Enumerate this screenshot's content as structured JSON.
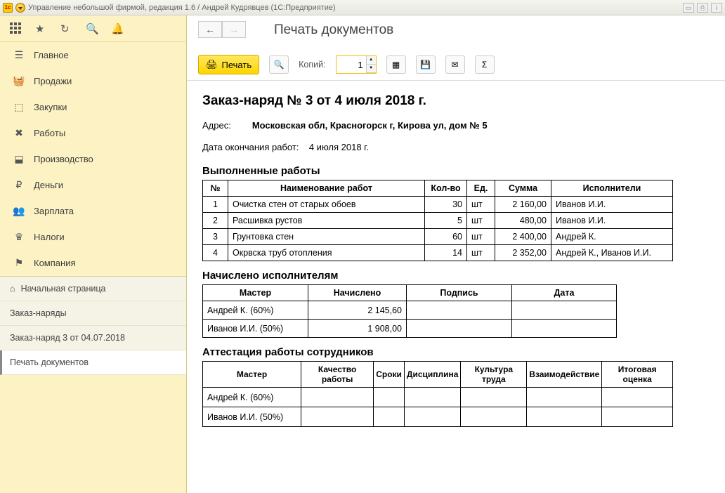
{
  "app": {
    "title": "Управление небольшой фирмой, редакция 1.6 / Андрей Кудрявцев  (1С:Предприятие)"
  },
  "sidebar": {
    "items": [
      {
        "icon": "☰",
        "label": "Главное"
      },
      {
        "icon": "🧺",
        "label": "Продажи"
      },
      {
        "icon": "⬚",
        "label": "Закупки"
      },
      {
        "icon": "✖",
        "label": "Работы"
      },
      {
        "icon": "⬓",
        "label": "Производство"
      },
      {
        "icon": "₽",
        "label": "Деньги"
      },
      {
        "icon": "👥",
        "label": "Зарплата"
      },
      {
        "icon": "♛",
        "label": "Налоги"
      },
      {
        "icon": "⚑",
        "label": "Компания"
      }
    ],
    "sub": [
      {
        "icon": "⌂",
        "label": "Начальная страница"
      },
      {
        "icon": "",
        "label": "Заказ-наряды"
      },
      {
        "icon": "",
        "label": "Заказ-наряд 3 от 04.07.2018"
      },
      {
        "icon": "",
        "label": "Печать документов"
      }
    ]
  },
  "page": {
    "title": "Печать документов",
    "print_label": "Печать",
    "copies_label": "Копий:",
    "copies_value": "1"
  },
  "document": {
    "title": "Заказ-наряд № 3 от 4 июля 2018 г.",
    "address_label": "Адрес:",
    "address_value": "Московская обл, Красногорск г, Кирова ул, дом № 5",
    "enddate_label": "Дата окончания работ:",
    "enddate_value": "4 июля 2018 г.",
    "works": {
      "heading": "Выполненные работы",
      "headers": [
        "№",
        "Наименование работ",
        "Кол-во",
        "Ед.",
        "Сумма",
        "Исполнители"
      ],
      "rows": [
        {
          "n": "1",
          "name": "Очистка стен от старых обоев",
          "qty": "30",
          "unit": "шт",
          "sum": "2 160,00",
          "exec": "Иванов И.И."
        },
        {
          "n": "2",
          "name": "Расшивка рустов",
          "qty": "5",
          "unit": "шт",
          "sum": "480,00",
          "exec": "Иванов И.И."
        },
        {
          "n": "3",
          "name": "Грунтовка стен",
          "qty": "60",
          "unit": "шт",
          "sum": "2 400,00",
          "exec": "Андрей К."
        },
        {
          "n": "4",
          "name": "Окрвска труб отопления",
          "qty": "14",
          "unit": "шт",
          "sum": "2 352,00",
          "exec": "Андрей К., Иванов И.И."
        }
      ]
    },
    "accrued": {
      "heading": "Начислено исполнителям",
      "headers": [
        "Мастер",
        "Начислено",
        "Подпись",
        "Дата"
      ],
      "rows": [
        {
          "master": "Андрей К. (60%)",
          "amount": "2 145,60"
        },
        {
          "master": "Иванов И.И. (50%)",
          "amount": "1 908,00"
        }
      ]
    },
    "attest": {
      "heading": "Аттестация работы сотрудников",
      "headers": [
        "Мастер",
        "Качество работы",
        "Сроки",
        "Дисциплина",
        "Культура труда",
        "Взаимодействие",
        "Итоговая оценка"
      ],
      "rows": [
        {
          "master": "Андрей К. (60%)"
        },
        {
          "master": "Иванов И.И. (50%)"
        }
      ]
    }
  }
}
